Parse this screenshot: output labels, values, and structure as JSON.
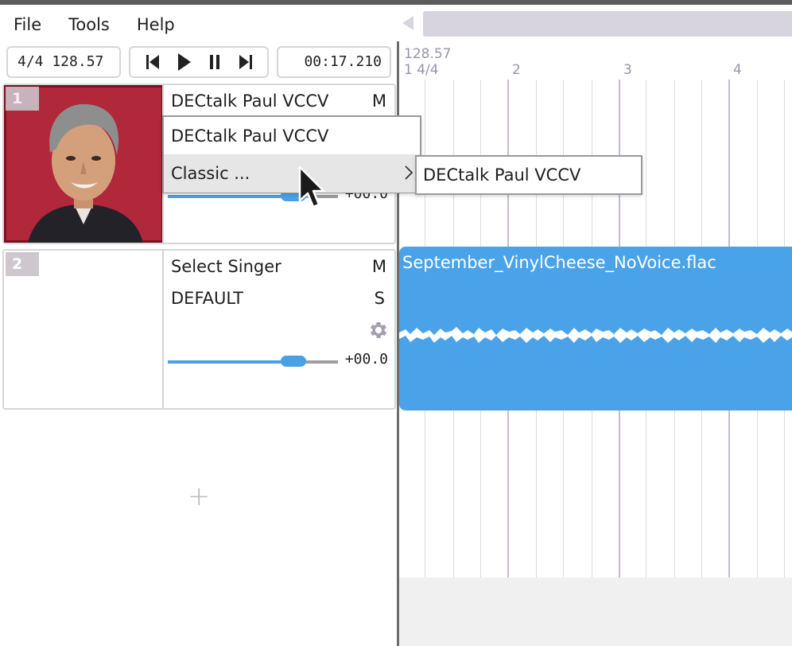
{
  "menu": {
    "items": [
      "File",
      "Tools",
      "Help"
    ]
  },
  "toolbar": {
    "tempo_display": "4/4  128.57",
    "time_display": "00:17.210",
    "buttons": [
      "skip-back-icon",
      "play-icon",
      "pause-icon",
      "skip-forward-icon"
    ]
  },
  "timeline": {
    "tempo_marker": "128.57",
    "time_signature": "1 4/4",
    "bars": [
      "2",
      "3",
      "4"
    ]
  },
  "tracks": [
    {
      "number": "1",
      "singer": "DECtalk Paul VCCV",
      "mute_label": "M",
      "volume": "+00.0",
      "volume_fraction": 0.74
    },
    {
      "number": "2",
      "singer": "Select Singer",
      "renderer": "DEFAULT",
      "mute_label": "M",
      "solo_label": "S",
      "volume": "+00.0",
      "volume_fraction": 0.74
    }
  ],
  "add_track_label": "+",
  "audio_part": {
    "filename": "September_VinylCheese_NoVoice.flac"
  },
  "singer_menu": {
    "items": [
      "DECtalk Paul VCCV",
      "Classic ..."
    ],
    "submenu_items": [
      "DECtalk Paul VCCV"
    ]
  },
  "colors": {
    "accent": "#4aa3e8",
    "track_number_bg": "#c9c3c9",
    "grid_bar": "#c4bccc"
  }
}
